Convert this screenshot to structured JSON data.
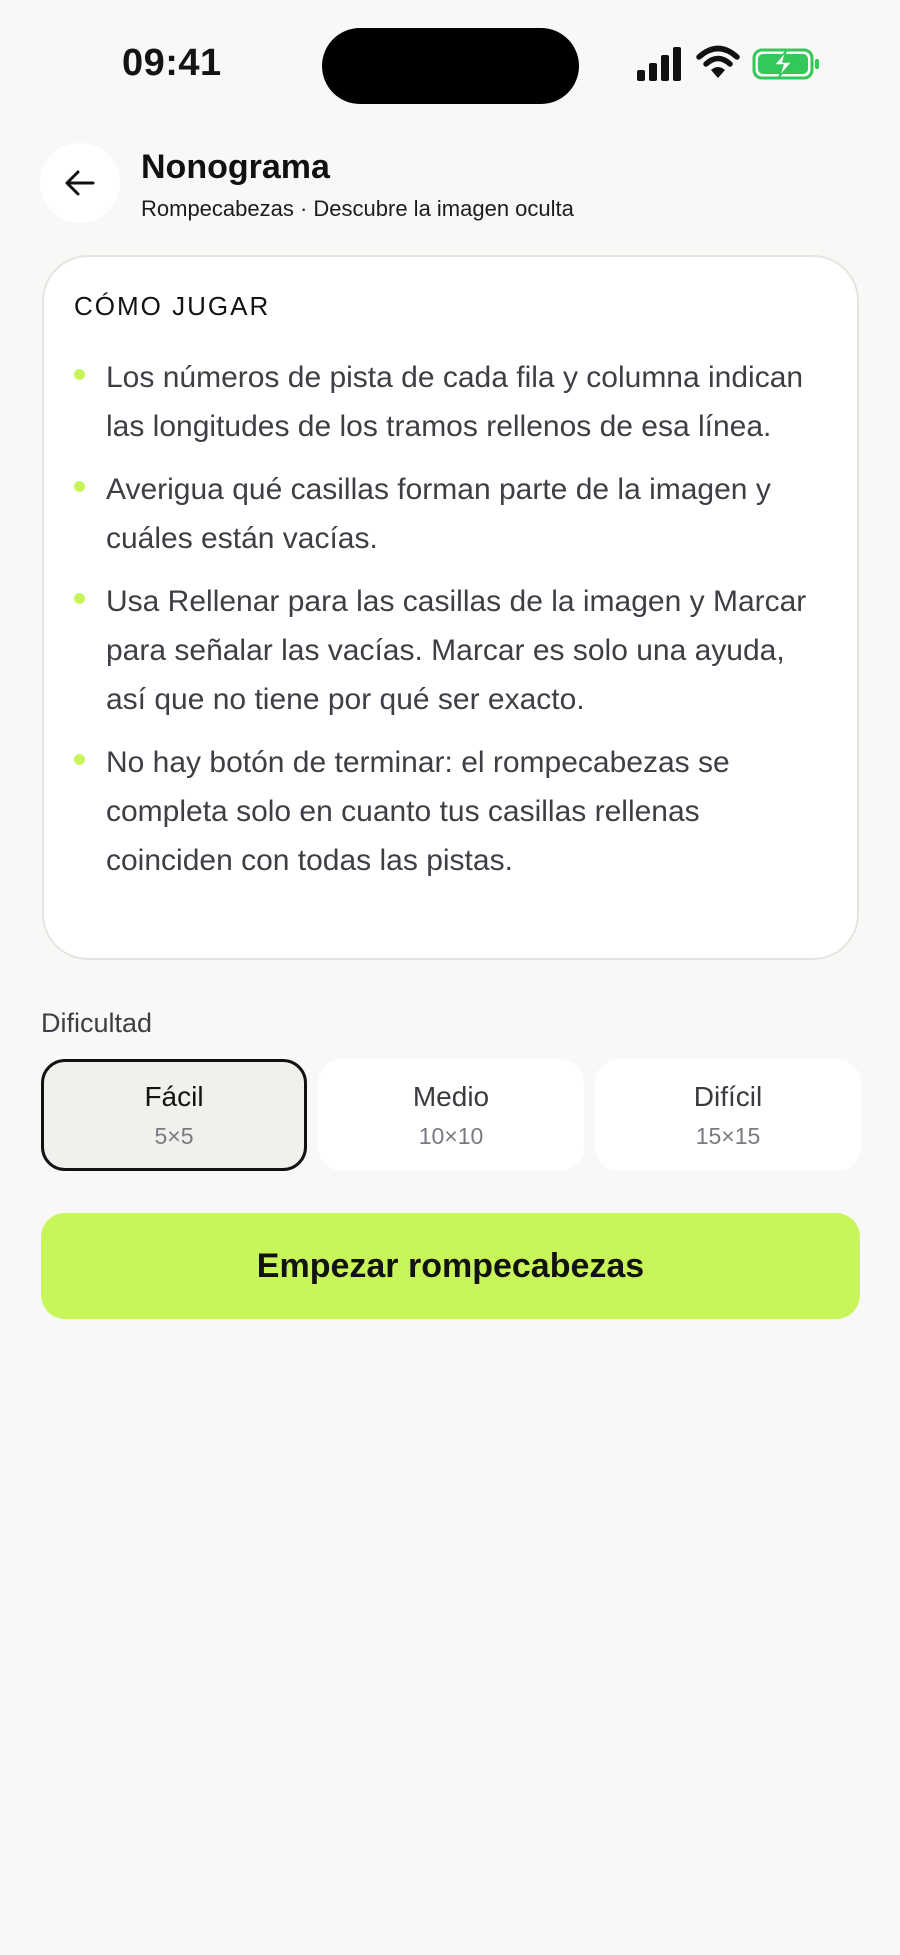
{
  "status_bar": {
    "time": "09:41"
  },
  "header": {
    "title": "Nonograma",
    "subtitle": "Rompecabezas · Descubre la imagen oculta"
  },
  "how_to_play": {
    "heading": "CÓMO JUGAR",
    "rules": [
      "Los números de pista de cada fila y columna indican las longitudes de los tramos rellenos de esa línea.",
      "Averigua qué casillas forman parte de la imagen y cuáles están vacías.",
      "Usa Rellenar para las casillas de la imagen y Marcar para señalar las vacías. Marcar es solo una ayuda, así que no tiene por qué ser exacto.",
      "No hay botón de terminar: el rompecabezas se completa solo en cuanto tus casillas rellenas coinciden con todas las pistas."
    ]
  },
  "difficulty": {
    "label": "Dificultad",
    "selected": "Fácil",
    "options": [
      {
        "name": "Fácil",
        "size": "5×5"
      },
      {
        "name": "Medio",
        "size": "10×10"
      },
      {
        "name": "Difícil",
        "size": "15×15"
      }
    ]
  },
  "start_button": {
    "label": "Empezar rompecabezas"
  },
  "colors": {
    "accent": "#c8f65a",
    "background": "#f8f8f6",
    "card": "#ffffff",
    "battery": "#34c759"
  },
  "icons": {
    "back": "arrow-left-icon",
    "signal": "cellular-signal-icon",
    "wifi": "wifi-icon",
    "battery": "battery-charging-icon"
  }
}
